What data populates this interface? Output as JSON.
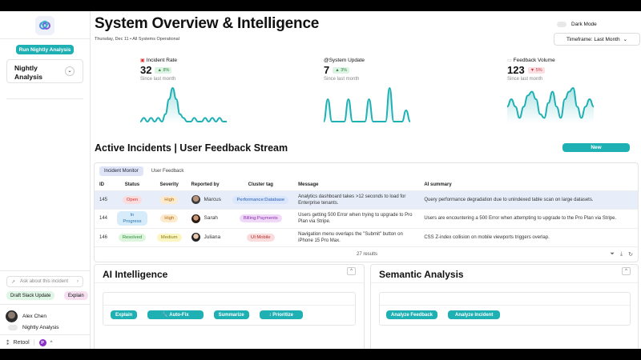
{
  "sidebar": {
    "run_button": "Run Nightly Analysis",
    "nightly_card": "Nightly Analysis",
    "ask_placeholder": "Ask about this incident",
    "chips": [
      "Draft Slack Update",
      "Explain"
    ],
    "user_name": "Alex Chen",
    "toggle_label": "Nightly Analysis",
    "brand": "Retool",
    "workspace_initial": "P"
  },
  "header": {
    "title": "System Overview & Intelligence",
    "subtitle": "Thursday, Dec 11 • All Systems Operational",
    "dark_mode": "Dark Mode",
    "timeframe": "Timeframe: Last Month"
  },
  "kpis": [
    {
      "label": "Incident Rate",
      "icon": "alert-icon",
      "value": "32",
      "delta": "8%",
      "dir": "up",
      "since": "Since last month",
      "series": [
        0,
        1,
        0,
        1,
        0,
        1,
        0,
        2,
        6,
        9,
        6,
        2,
        1,
        0,
        0,
        1,
        0,
        0,
        1,
        0,
        1,
        0,
        1,
        0,
        0
      ]
    },
    {
      "label": "@System Update",
      "icon": "",
      "value": "7",
      "delta": "3%",
      "dir": "up",
      "since": "Since last month",
      "series": [
        0,
        6,
        0,
        0,
        0,
        0,
        6,
        0,
        0,
        0,
        0,
        6,
        0,
        0,
        0,
        0,
        9,
        0,
        0,
        0,
        3,
        0
      ]
    },
    {
      "label": "Feedback Volume",
      "icon": "chat-icon",
      "value": "123",
      "delta": "5%",
      "dir": "down",
      "since": "Since last month",
      "series": [
        4,
        6,
        4,
        1,
        4,
        7,
        8,
        6,
        2,
        1,
        5,
        8,
        4,
        1,
        6,
        8,
        9,
        4,
        1,
        4,
        6,
        4
      ]
    }
  ],
  "section_title": "Active Incidents | User Feedback Stream",
  "new_button": "New",
  "table": {
    "tabs": [
      "Incident Monitor",
      "User Feedback"
    ],
    "columns": [
      "ID",
      "Status",
      "Severity",
      "Reported by",
      "Cluster tag",
      "Message",
      "AI summary"
    ],
    "rows": [
      {
        "id": "145",
        "status": "Open",
        "severity": "High",
        "reporter": "Marcus",
        "tag": "Performance:Database",
        "message": "Analytics dashboard takes >12 seconds to load for Enterprise tenants.",
        "summary": "Query performance degradation due to unindexed table scan on large datasets."
      },
      {
        "id": "144",
        "status": "In Progress",
        "severity": "High",
        "reporter": "Sarah",
        "tag": "Billing:Payments",
        "message": "Users getting 500 Error when trying to upgrade to Pro Plan via Stripe.",
        "summary": "Users are encountering a 500 Error when attempting to upgrade to the Pro Plan via Stripe."
      },
      {
        "id": "146",
        "status": "Resolved",
        "severity": "Medium",
        "reporter": "Juliana",
        "tag": "UI:Mobile",
        "message": "Navigation menu overlaps the \"Submit\" button on iPhone 15 Pro Max.",
        "summary": "CSS Z-index collision on mobile viewports triggers overlap."
      }
    ],
    "results": "27 results"
  },
  "ai_panel": {
    "title": "AI Intelligence",
    "buttons": [
      "Explain",
      "🔧 Auto-Fix",
      "Summarize",
      "↕ Prioritize"
    ]
  },
  "semantic_panel": {
    "title": "Semantic Analysis",
    "buttons": [
      "Analyze Feedback",
      "Analyze Incident"
    ]
  },
  "colors": {
    "accent": "#1fb0b4"
  }
}
